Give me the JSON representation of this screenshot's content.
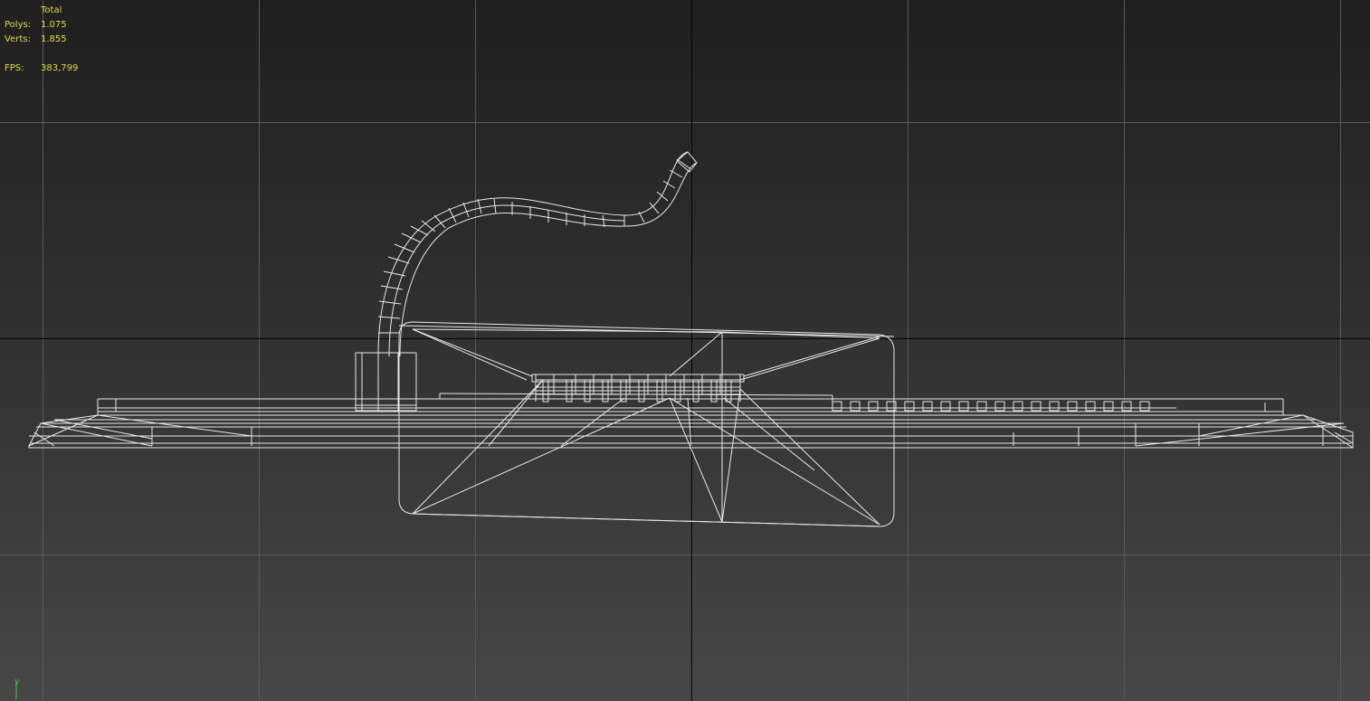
{
  "viewport": {
    "background_top": "#1f1f1f",
    "background_bottom": "#474747",
    "grid_color": "#5a5a5a",
    "axis_color": "#000000",
    "wire_color": "#e8e8e8"
  },
  "stats": {
    "header": "Total",
    "polys_label": "Polys:",
    "polys_value": "1.075",
    "verts_label": "Verts:",
    "verts_value": "1.855",
    "fps_label": "FPS:",
    "fps_value": "383,799",
    "text_color": "#e6d84a"
  },
  "axis_tripod": {
    "label": "y",
    "color": "#46c846",
    "icon": "axis-tripod-icon"
  }
}
